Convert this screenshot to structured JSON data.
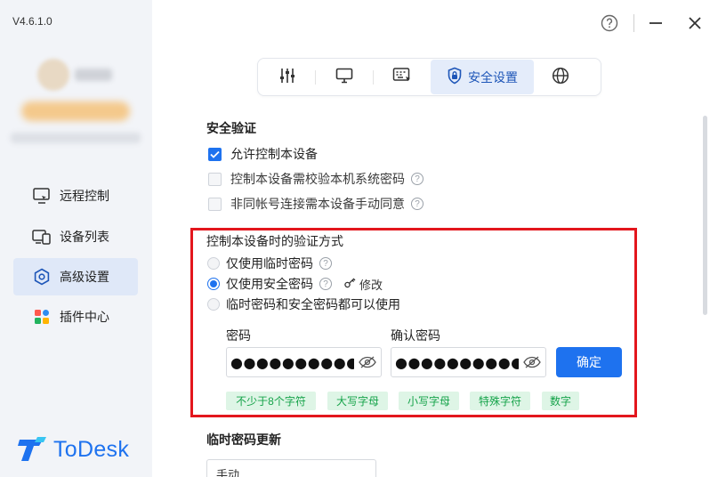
{
  "app": {
    "version": "V4.6.1.0",
    "logo_text": "ToDesk",
    "accent_color": "#1e72ef",
    "highlight_color": "#e3161d"
  },
  "sidebar": {
    "items": [
      {
        "label": "远程控制",
        "icon": "monitor-remote-icon"
      },
      {
        "label": "设备列表",
        "icon": "devices-icon"
      },
      {
        "label": "高级设置",
        "icon": "hexagon-settings-icon",
        "active": true
      },
      {
        "label": "插件中心",
        "icon": "plugins-icon"
      }
    ]
  },
  "window_controls": [
    "help-icon",
    "minimize-icon",
    "close-icon"
  ],
  "tabs": [
    {
      "icon": "sliders-icon"
    },
    {
      "icon": "monitor-icon"
    },
    {
      "icon": "keyboard-cursor-icon"
    },
    {
      "icon": "shield-lock-icon",
      "label": "安全设置",
      "active": true
    },
    {
      "icon": "globe-icon"
    }
  ],
  "security": {
    "title": "安全验证",
    "options": [
      {
        "label": "允许控制本设备",
        "checked": true
      },
      {
        "label": "控制本设备需校验本机系统密码",
        "checked": false,
        "help": true
      },
      {
        "label": "非同帐号连接需本设备手动同意",
        "checked": false,
        "help": true
      }
    ]
  },
  "verify": {
    "title": "控制本设备时的验证方式",
    "options": [
      {
        "label": "仅使用临时密码",
        "selected": false,
        "help": true
      },
      {
        "label": "仅使用安全密码",
        "selected": true,
        "help": true
      },
      {
        "label": "临时密码和安全密码都可以使用",
        "selected": false
      }
    ],
    "edit_label": "修改",
    "password_label": "密码",
    "password_mask": "●●●●●●●●●●●●●●●",
    "confirm_label": "确认密码",
    "confirm_mask": "●●●●●●●●●●●●●",
    "confirm_button": "确定",
    "rules": [
      "不少于8个字符",
      "大写字母",
      "小写字母",
      "特殊字符",
      "数字"
    ]
  },
  "temp_password": {
    "title": "临时密码更新",
    "select_value": "手动"
  }
}
